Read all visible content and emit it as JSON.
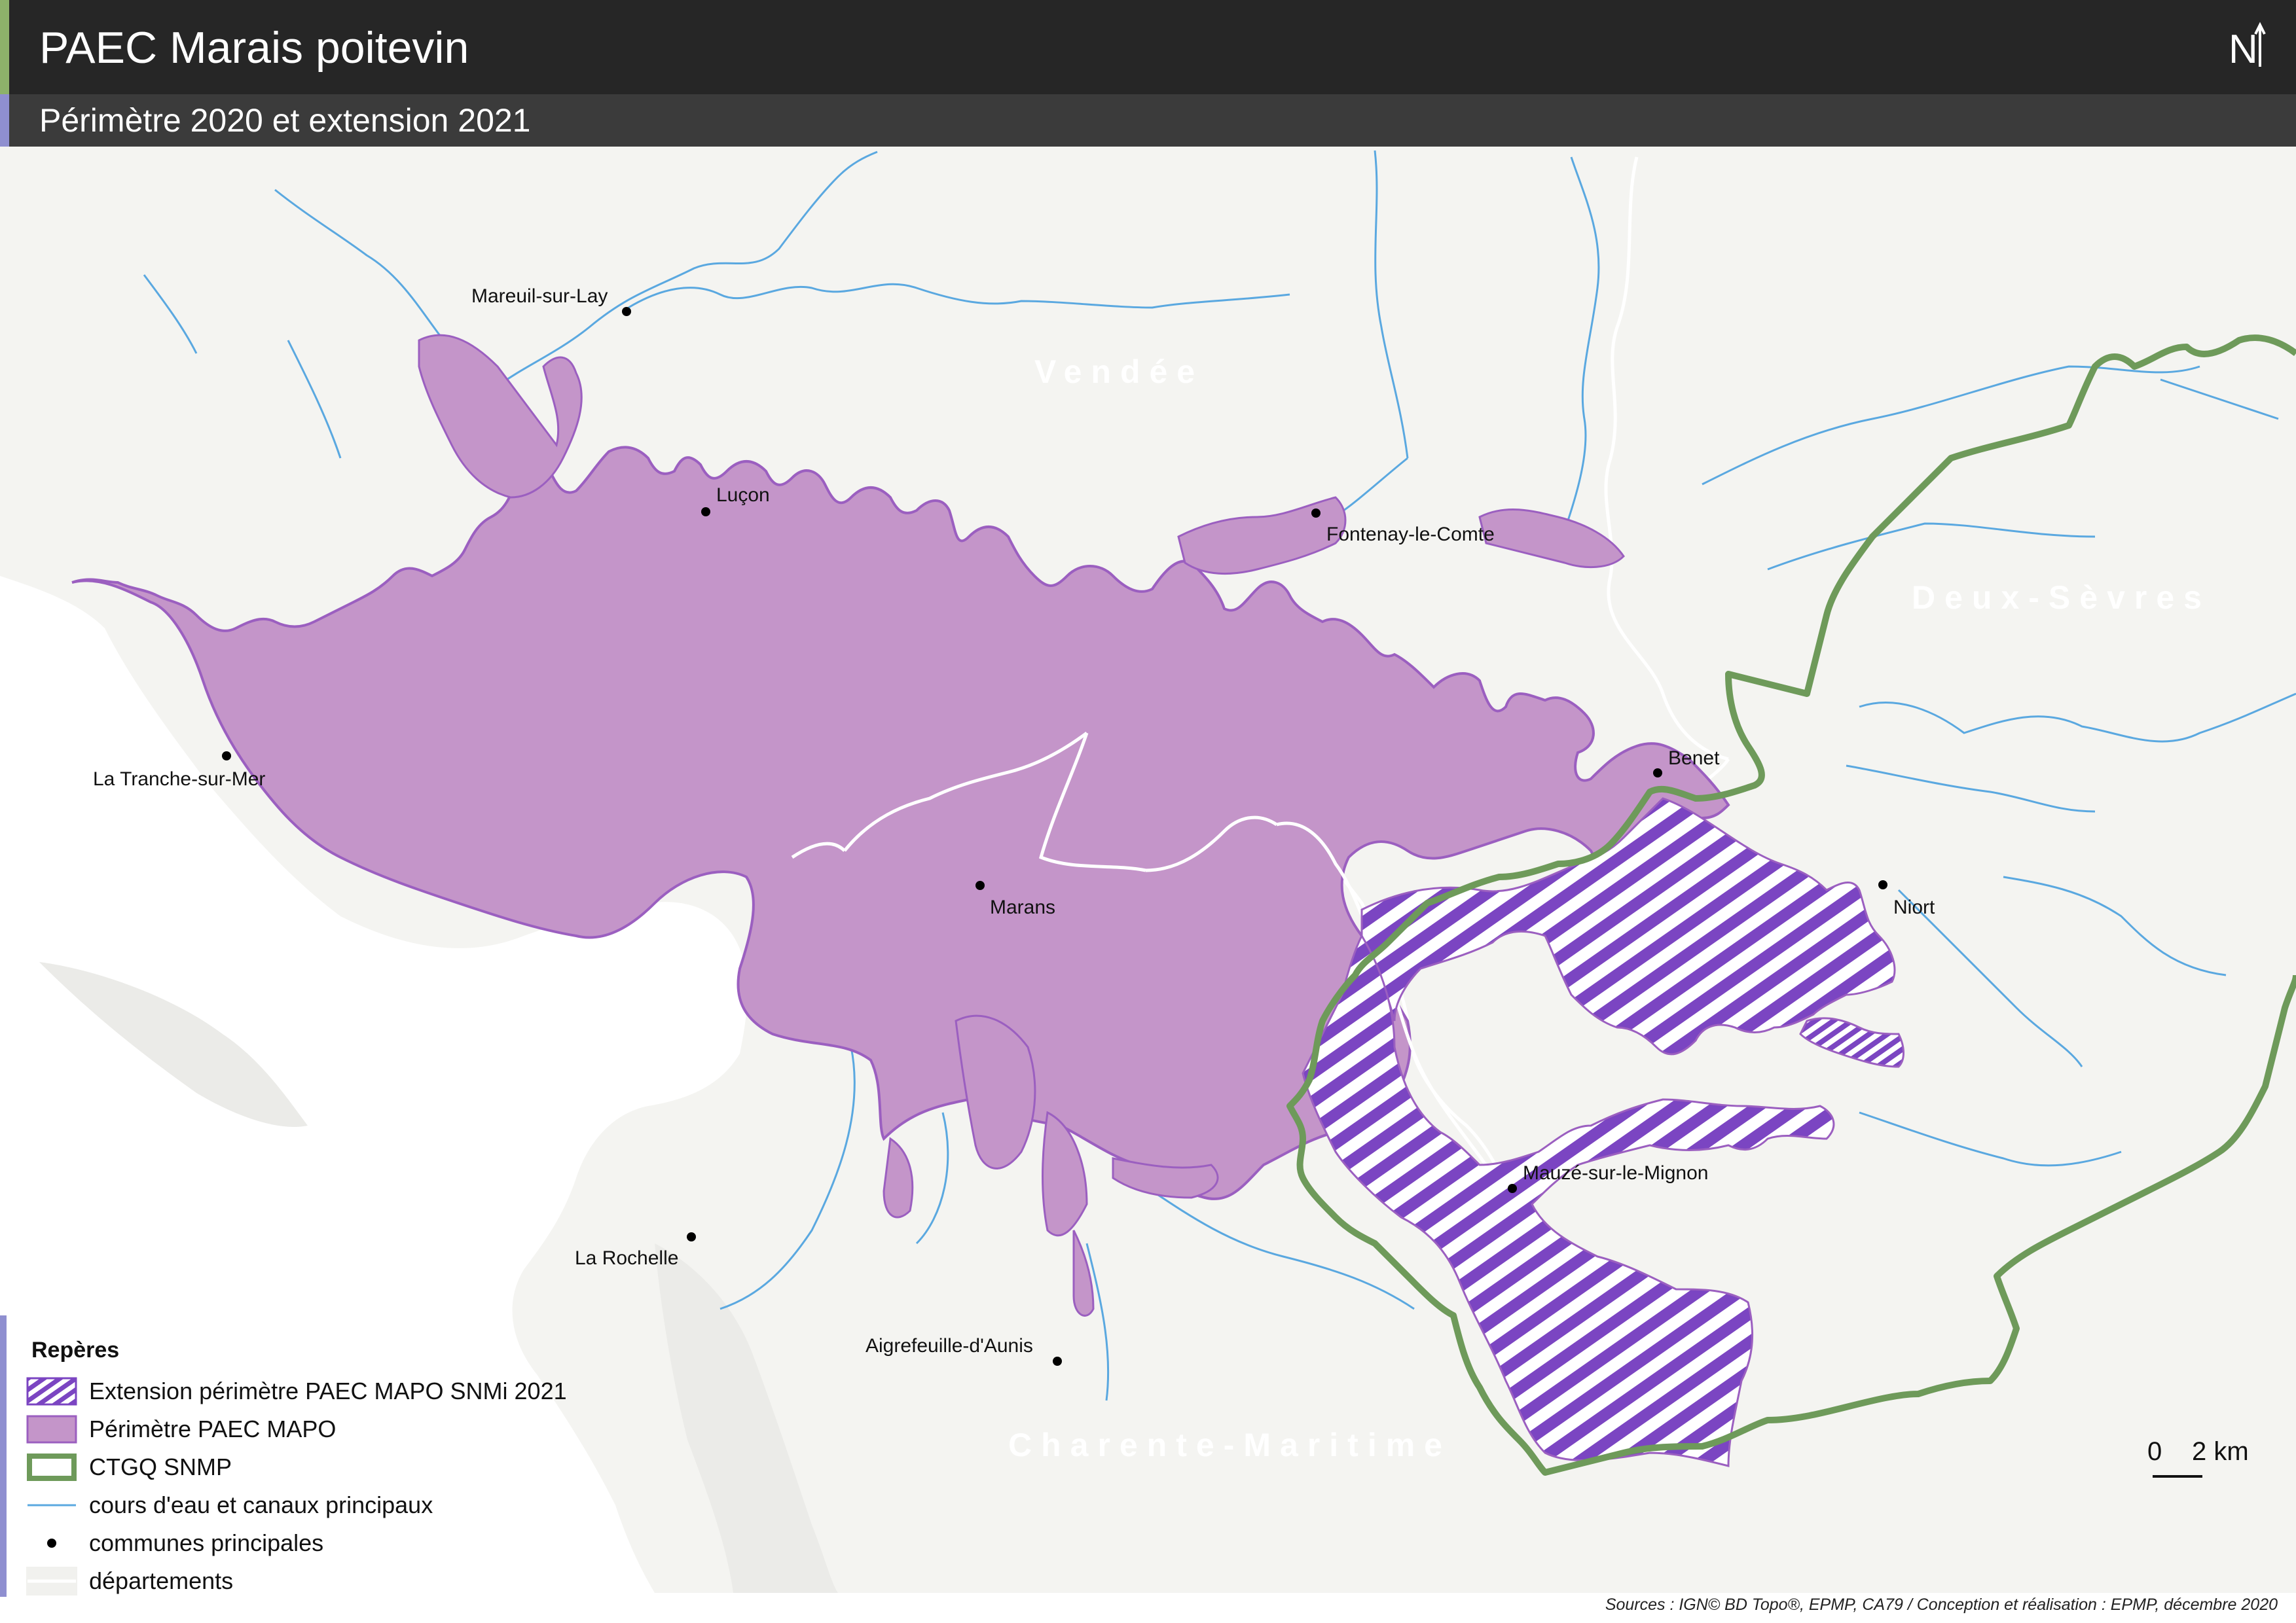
{
  "header": {
    "title": "PAEC Marais poitevin",
    "subtitle": "Périmètre 2020 et extension 2021",
    "north_label": "N"
  },
  "map": {
    "departments": [
      "Vendée",
      "Deux-Sèvres",
      "Charente-Maritime"
    ],
    "towns": [
      {
        "name": "Mareuil-sur-Lay"
      },
      {
        "name": "Luçon"
      },
      {
        "name": "Fontenay-le-Comte"
      },
      {
        "name": "La Tranche-sur-Mer"
      },
      {
        "name": "Benet"
      },
      {
        "name": "Marans"
      },
      {
        "name": "Niort"
      },
      {
        "name": "Mauzé-sur-le-Mignon"
      },
      {
        "name": "La Rochelle"
      },
      {
        "name": "Aigrefeuille-d'Aunis"
      }
    ]
  },
  "legend": {
    "title": "Repères",
    "items": [
      {
        "label": "Extension périmètre PAEC MAPO SNMi 2021",
        "symbol": "hatch-purple"
      },
      {
        "label": "Périmètre PAEC MAPO",
        "symbol": "fill-purple"
      },
      {
        "label": "CTGQ SNMP",
        "symbol": "outline-green"
      },
      {
        "label": "cours d'eau et canaux principaux",
        "symbol": "line-blue"
      },
      {
        "label": "communes principales",
        "symbol": "dot-black"
      },
      {
        "label": "départements",
        "symbol": "line-white"
      }
    ]
  },
  "scale": {
    "zero": "0",
    "label": "2 km"
  },
  "sources": "Sources : IGN© BD Topo®, EPMP, CA79 / Conception et réalisation : EPMP, décembre 2020",
  "colors": {
    "perimeter_fill": "#c495c9",
    "perimeter_stroke": "#9b5fc0",
    "hatch": "#7b45c2",
    "ctgq": "#6e9a5a",
    "water": "#5aa8e0",
    "land": "#f4f4f1",
    "sea": "#ffffff"
  }
}
